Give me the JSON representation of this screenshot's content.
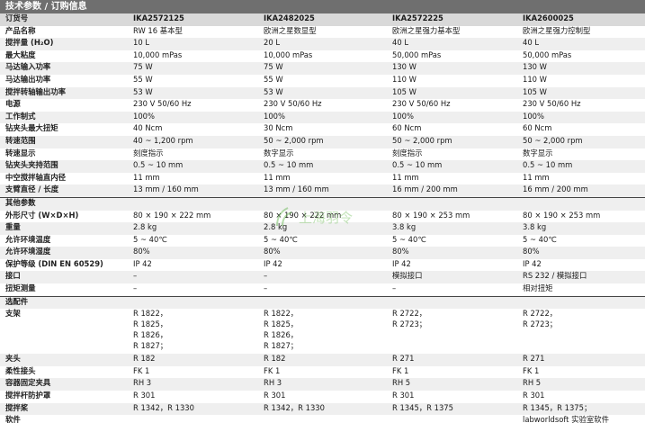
{
  "title": "技术参数 / 订购信息",
  "header": {
    "label": "订货号",
    "values": [
      "IKA2572125",
      "IKA2482025",
      "IKA2572225",
      "IKA2600025"
    ]
  },
  "rows1": [
    {
      "label": "产品名称",
      "values": [
        "RW 16 基本型",
        "欧洲之星数显型",
        "欧洲之星强力基本型",
        "欧洲之星强力控制型"
      ]
    },
    {
      "label": "搅拌量 (H₂O)",
      "values": [
        "10 L",
        "20 L",
        "40 L",
        "40 L"
      ]
    },
    {
      "label": "最大粘度",
      "values": [
        "10,000 mPas",
        "10,000 mPas",
        "50,000 mPas",
        "50,000 mPas"
      ]
    },
    {
      "label": "马达输入功率",
      "values": [
        "75 W",
        "75 W",
        " 130 W",
        "130 W"
      ]
    },
    {
      "label": "马达输出功率",
      "values": [
        "55 W",
        "55 W",
        "110 W",
        "110 W"
      ]
    },
    {
      "label": "搅拌转轴输出功率",
      "values": [
        "53 W",
        "53 W",
        "105 W",
        "105 W"
      ]
    },
    {
      "label": "电源",
      "values": [
        "230 V 50/60 Hz",
        "230 V 50/60 Hz",
        "230 V 50/60 Hz",
        "230 V 50/60 Hz"
      ]
    },
    {
      "label": "工作制式",
      "values": [
        "100%",
        "100%",
        "100%",
        "100%"
      ]
    },
    {
      "label": "钻夹头最大扭矩",
      "values": [
        "40 Ncm",
        "30 Ncm",
        "60 Ncm",
        "60 Ncm"
      ]
    },
    {
      "label": "转速范围",
      "values": [
        "40 ~ 1,200 rpm",
        "50 ~ 2,000 rpm",
        "50 ~ 2,000 rpm",
        "50 ~ 2,000 rpm"
      ]
    },
    {
      "label": "转速显示",
      "values": [
        "刻度指示",
        "数字显示",
        "刻度指示",
        "数字显示"
      ]
    },
    {
      "label": "钻夹头夹持范围",
      "values": [
        "0.5 ~ 10 mm",
        "0.5 ~ 10 mm",
        "0.5 ~ 10 mm",
        "0.5 ~ 10 mm"
      ]
    },
    {
      "label": "中空搅拌轴直内径",
      "values": [
        "11 mm",
        "11 mm",
        "11 mm",
        "11 mm"
      ]
    },
    {
      "label": "支臂直径 / 长度",
      "values": [
        "13 mm / 160 mm",
        "13 mm / 160 mm",
        "16 mm / 200 mm",
        "16 mm / 200 mm"
      ]
    }
  ],
  "section2": "其他参数",
  "rows2": [
    {
      "label": "外形尺寸 (W×D×H)",
      "values": [
        "80 × 190 × 222 mm",
        "80 × 190 × 222 mm",
        "80 × 190 × 253 mm",
        "80 × 190 × 253 mm"
      ]
    },
    {
      "label": "重量",
      "values": [
        "2.8 kg",
        "2.8 kg",
        "3.8 kg",
        "3.8 kg"
      ]
    },
    {
      "label": "允许环境温度",
      "values": [
        "5 ~ 40℃",
        "5 ~ 40℃",
        "5 ~ 40℃",
        "5 ~ 40℃"
      ]
    },
    {
      "label": "允许环境湿度",
      "values": [
        "80%",
        "80%",
        "80%",
        "80%"
      ]
    },
    {
      "label": "保护等级 (DIN EN 60529)",
      "values": [
        "IP 42",
        "IP 42",
        "IP 42",
        "IP 42"
      ]
    },
    {
      "label": "接口",
      "values": [
        "–",
        "–",
        "模拟接口",
        "RS 232 / 模拟接口"
      ]
    },
    {
      "label": "扭矩测量",
      "values": [
        "–",
        "–",
        "–",
        "相对扭矩"
      ]
    }
  ],
  "section3": "选配件",
  "rows3": [
    {
      "label": "支架",
      "values": [
        "R 1822，\nR 1825，\nR 1826，\nR 1827；",
        "R 1822，\nR 1825，\nR 1826，\nR 1827；",
        "R 2722，\nR 2723；",
        "R 2722，\nR 2723；"
      ]
    },
    {
      "label": "夹头",
      "values": [
        "R 182",
        "R 182",
        "R 271",
        "R 271"
      ]
    },
    {
      "label": "柔性接头",
      "values": [
        "FK 1",
        "FK 1",
        "FK 1",
        "FK 1"
      ]
    },
    {
      "label": "容器固定夹具",
      "values": [
        "RH 3",
        "RH 3",
        "RH 5",
        "RH 5"
      ]
    },
    {
      "label": "搅拌杆防护罩",
      "values": [
        "R 301",
        "R 301",
        "R 301",
        "R 301"
      ]
    },
    {
      "label": "搅拌桨",
      "values": [
        "R 1342，R 1330",
        "R 1342，R 1330",
        "R 1345，R 1375",
        "R 1345，R 1375；"
      ]
    },
    {
      "label": "软件",
      "values": [
        "",
        "",
        "",
        "labworldsoft 实验室软件"
      ]
    }
  ],
  "watermark": "上海羽令"
}
